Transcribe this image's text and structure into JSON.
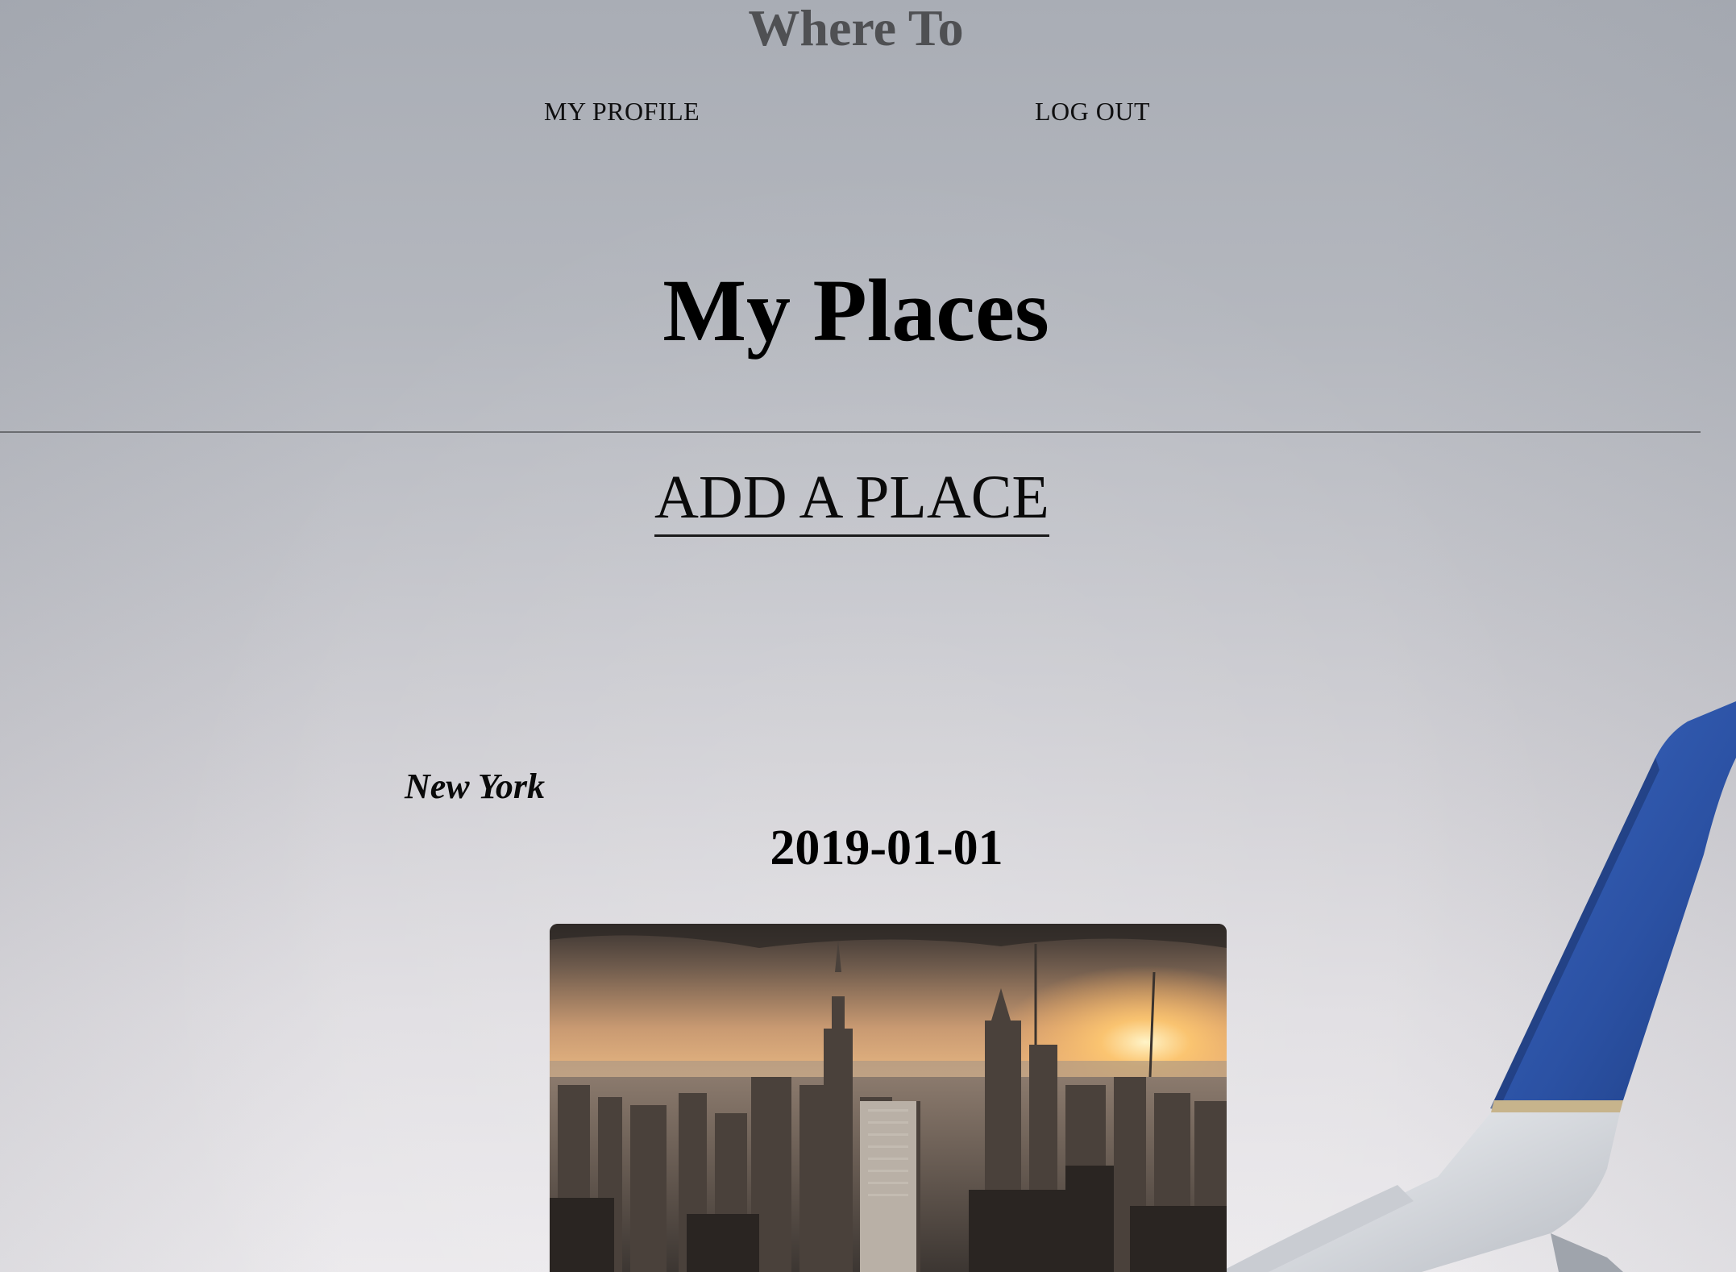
{
  "header": {
    "site_title": "Where To"
  },
  "nav": {
    "profile_label": "MY PROFILE",
    "logout_label": "LOG OUT"
  },
  "main": {
    "page_title": "My Places",
    "add_place_label": "ADD A PLACE"
  },
  "places": [
    {
      "name": "New York",
      "date": "2019-01-01"
    }
  ],
  "colors": {
    "background_top": "#a9adb5",
    "background_bottom": "#ebe9ec",
    "site_title": "#4f5053",
    "wing_blue": "#2d55a8"
  }
}
